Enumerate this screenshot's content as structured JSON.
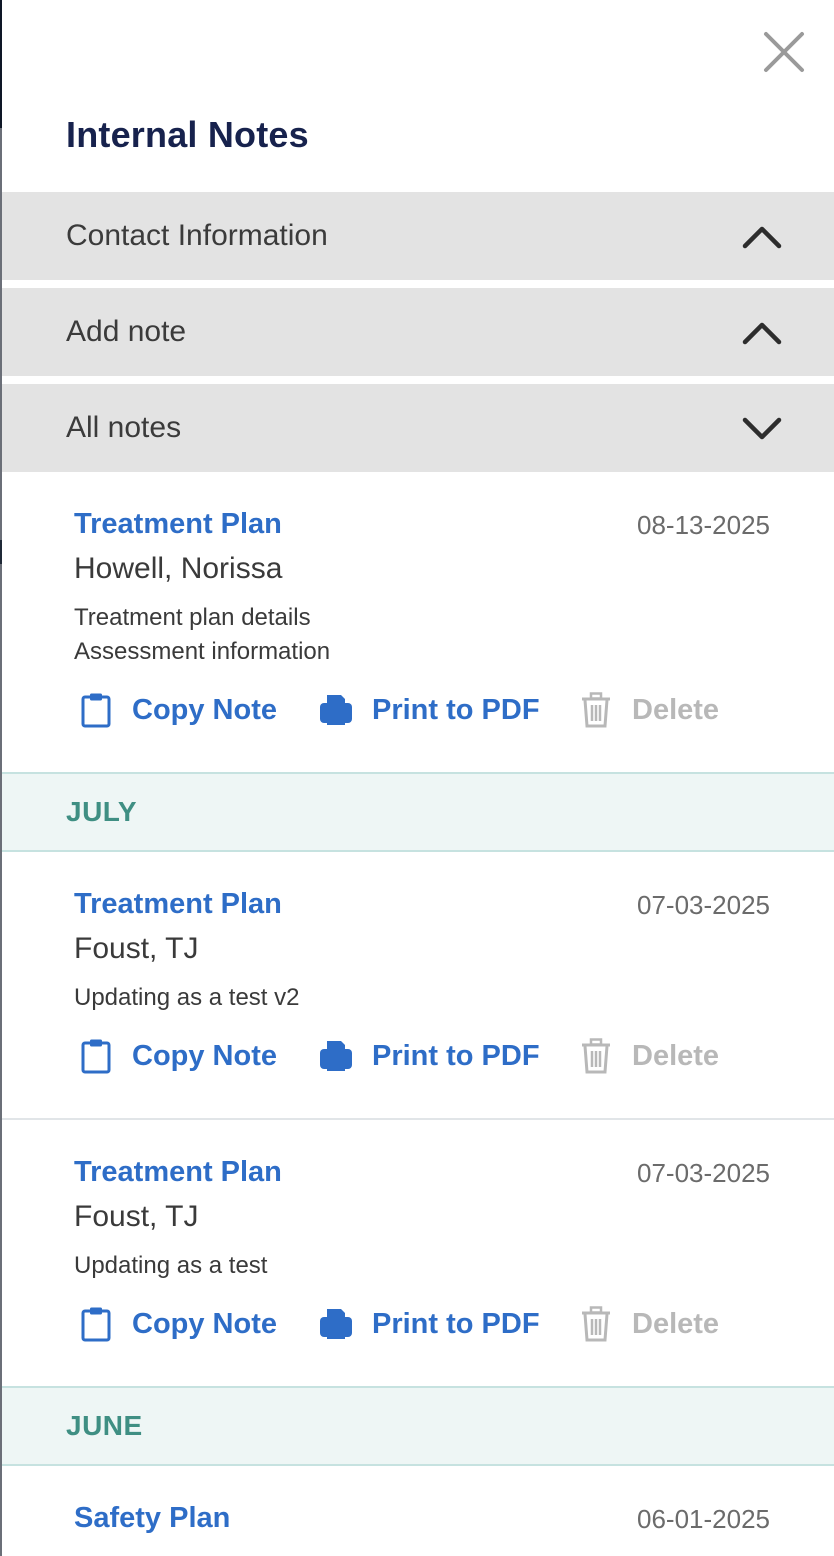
{
  "header": {
    "title": "Internal Notes",
    "close_icon": "close-icon"
  },
  "sections": {
    "contact": {
      "label": "Contact Information",
      "icon": "chevron-up-icon"
    },
    "add_note": {
      "label": "Add note",
      "icon": "chevron-up-icon"
    },
    "all_notes": {
      "label": "All notes",
      "icon": "chevron-down-icon"
    }
  },
  "actions": {
    "copy_label": "Copy Note",
    "copy_icon": "clipboard-icon",
    "print_label": "Print to PDF",
    "print_icon": "printer-icon",
    "delete_label": "Delete",
    "delete_icon": "trash-icon"
  },
  "months": {
    "july": "JULY",
    "june": "JUNE"
  },
  "notes": [
    {
      "type": "Treatment Plan",
      "date": "08-13-2025",
      "author": "Howell, Norissa",
      "lines": [
        "Treatment plan details",
        "Assessment information"
      ]
    },
    {
      "type": "Treatment Plan",
      "date": "07-03-2025",
      "author": "Foust, TJ",
      "lines": [
        "Updating as a test v2"
      ]
    },
    {
      "type": "Treatment Plan",
      "date": "07-03-2025",
      "author": "Foust, TJ",
      "lines": [
        "Updating as a test"
      ]
    },
    {
      "type": "Safety Plan",
      "date": "06-01-2025",
      "author": "",
      "lines": []
    }
  ],
  "colors": {
    "title": "#17224d",
    "link_blue": "#2e6dc7",
    "month_text": "#3f8f83",
    "month_bg": "#eef6f5",
    "accordion_bg": "#e3e3e3",
    "disabled": "#b8b8b8"
  }
}
